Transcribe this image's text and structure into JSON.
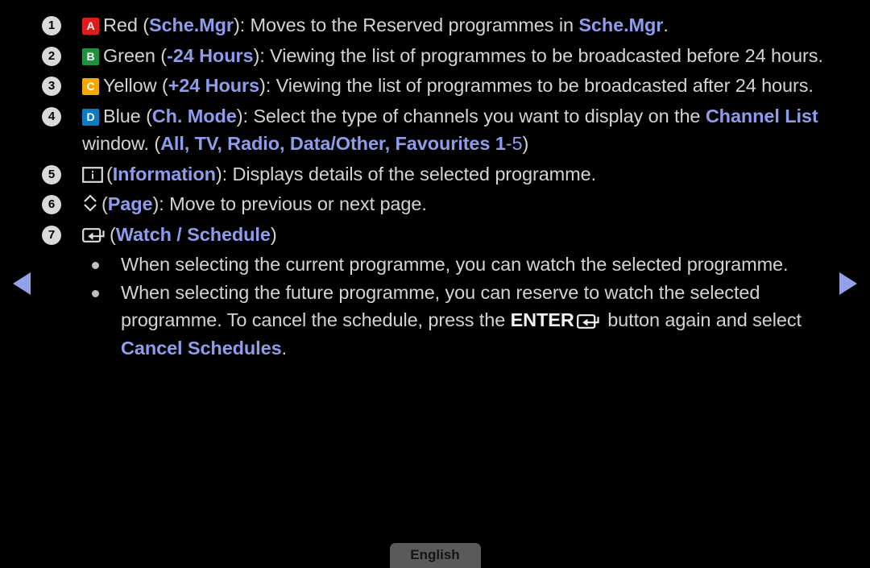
{
  "screen": {
    "background_color": "#000000",
    "text_color": "#d3d3d3",
    "highlight_color": "#8f9ceb"
  },
  "nav": {
    "prev_label": "◀",
    "next_label": "▶"
  },
  "items": [
    {
      "number": "1",
      "key_badge": {
        "letter": "A",
        "color_name": "red",
        "color": "#e01b1b"
      },
      "parts": [
        {
          "t": "Red (",
          "s": "plain"
        },
        {
          "t": "Sche.Mgr",
          "s": "hl"
        },
        {
          "t": "): Moves to the Reserved programmes in ",
          "s": "plain"
        },
        {
          "t": "Sche.Mgr",
          "s": "hl"
        },
        {
          "t": ".",
          "s": "plain"
        }
      ]
    },
    {
      "number": "2",
      "key_badge": {
        "letter": "B",
        "color_name": "green",
        "color": "#1f9242"
      },
      "parts": [
        {
          "t": "Green (",
          "s": "plain"
        },
        {
          "t": "-24 Hours",
          "s": "hl"
        },
        {
          "t": "): Viewing the list of programmes to be broadcasted before 24 hours.",
          "s": "plain"
        }
      ]
    },
    {
      "number": "3",
      "key_badge": {
        "letter": "C",
        "color_name": "yellow",
        "color": "#f5a800"
      },
      "parts": [
        {
          "t": "Yellow (",
          "s": "plain"
        },
        {
          "t": "+24 Hours",
          "s": "hl"
        },
        {
          "t": "): Viewing the list of programmes to be broadcasted after 24 hours.",
          "s": "plain"
        }
      ]
    },
    {
      "number": "4",
      "key_badge": {
        "letter": "D",
        "color_name": "blue",
        "color": "#0e7ac4"
      },
      "parts": [
        {
          "t": "Blue (",
          "s": "plain"
        },
        {
          "t": "Ch. Mode",
          "s": "hl"
        },
        {
          "t": "): Select the type of channels you want to display on the ",
          "s": "plain"
        },
        {
          "t": "Channel List",
          "s": "hl"
        },
        {
          "t": " window. (",
          "s": "plain"
        },
        {
          "t": "All, TV, Radio, Data/Other, Favourites 1",
          "s": "hl"
        },
        {
          "t": "-5",
          "s": "hl-plain"
        },
        {
          "t": ")",
          "s": "plain"
        }
      ]
    },
    {
      "number": "5",
      "icon": "information-icon",
      "parts": [
        {
          "t": "(",
          "s": "plain"
        },
        {
          "t": "Information",
          "s": "hl"
        },
        {
          "t": "): Displays details of the selected programme.",
          "s": "plain"
        }
      ]
    },
    {
      "number": "6",
      "icon": "up-down-chevron-icon",
      "parts": [
        {
          "t": "(",
          "s": "plain"
        },
        {
          "t": "Page",
          "s": "hl"
        },
        {
          "t": "): Move to previous or next page.",
          "s": "plain"
        }
      ]
    },
    {
      "number": "7",
      "icon": "enter-key-icon",
      "parts": [
        {
          "t": "(",
          "s": "plain"
        },
        {
          "t": "Watch / Schedule",
          "s": "hl"
        },
        {
          "t": ")",
          "s": "plain"
        }
      ]
    }
  ],
  "bullets": [
    {
      "parts": [
        {
          "t": "When selecting the current programme, you can watch the selected programme.",
          "s": "plain"
        }
      ]
    },
    {
      "parts": [
        {
          "t": "When selecting the future programme, you can reserve to watch the selected programme. To cancel the schedule, press the ",
          "s": "plain"
        },
        {
          "t": "ENTER",
          "s": "wh-bold"
        },
        {
          "t": "enter-key-icon",
          "s": "icon"
        },
        {
          "t": " button again and select ",
          "s": "plain"
        },
        {
          "t": "Cancel Schedules",
          "s": "hl"
        },
        {
          "t": ".",
          "s": "plain"
        }
      ]
    }
  ],
  "language_chip": {
    "label": "English"
  }
}
